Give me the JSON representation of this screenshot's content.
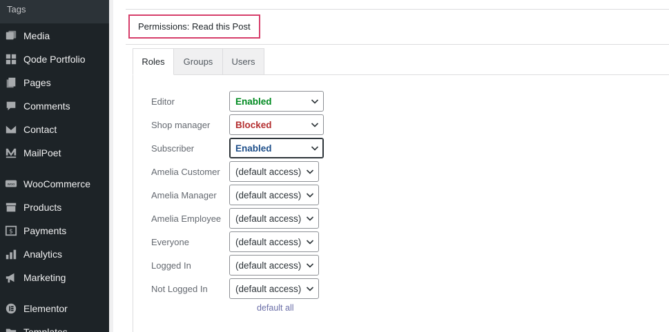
{
  "sidebar": {
    "top_label": "Tags",
    "items": [
      {
        "label": "Media",
        "icon": "media-icon"
      },
      {
        "label": "Qode Portfolio",
        "icon": "grid-icon"
      },
      {
        "label": "Pages",
        "icon": "pages-icon"
      },
      {
        "label": "Comments",
        "icon": "comment-icon"
      },
      {
        "label": "Contact",
        "icon": "envelope-icon"
      },
      {
        "label": "MailPoet",
        "icon": "mailpoet-icon"
      },
      {
        "label": "WooCommerce",
        "icon": "woo-icon"
      },
      {
        "label": "Products",
        "icon": "archive-icon"
      },
      {
        "label": "Payments",
        "icon": "dollar-icon"
      },
      {
        "label": "Analytics",
        "icon": "bar-chart-icon"
      },
      {
        "label": "Marketing",
        "icon": "megaphone-icon"
      },
      {
        "label": "Elementor",
        "icon": "elementor-icon"
      },
      {
        "label": "Templates",
        "icon": "folder-icon"
      }
    ]
  },
  "panel": {
    "title": "Permissions: Read this Post",
    "tabs": [
      {
        "label": "Roles",
        "active": true
      },
      {
        "label": "Groups",
        "active": false
      },
      {
        "label": "Users",
        "active": false
      }
    ],
    "roles": [
      {
        "label": "Editor",
        "value": "Enabled",
        "color": "#008a20"
      },
      {
        "label": "Shop manager",
        "value": "Blocked",
        "color": "#b32d2e"
      },
      {
        "label": "Subscriber",
        "value": "Enabled",
        "color": "#1d4e89"
      },
      {
        "label": "Amelia Customer",
        "value": "(default access)"
      },
      {
        "label": "Amelia Manager",
        "value": "(default access)"
      },
      {
        "label": "Amelia Employee",
        "value": "(default access)"
      },
      {
        "label": "Everyone",
        "value": "(default access)"
      },
      {
        "label": "Logged In",
        "value": "(default access)"
      },
      {
        "label": "Not Logged In",
        "value": "(default access)"
      }
    ],
    "default_all": "default all"
  },
  "colors": {
    "sidebar_bg": "#1d2327",
    "title_border": "#d63d6a",
    "enabled": "#008a20",
    "blocked": "#b32d2e",
    "link": "#6b6fa8"
  }
}
